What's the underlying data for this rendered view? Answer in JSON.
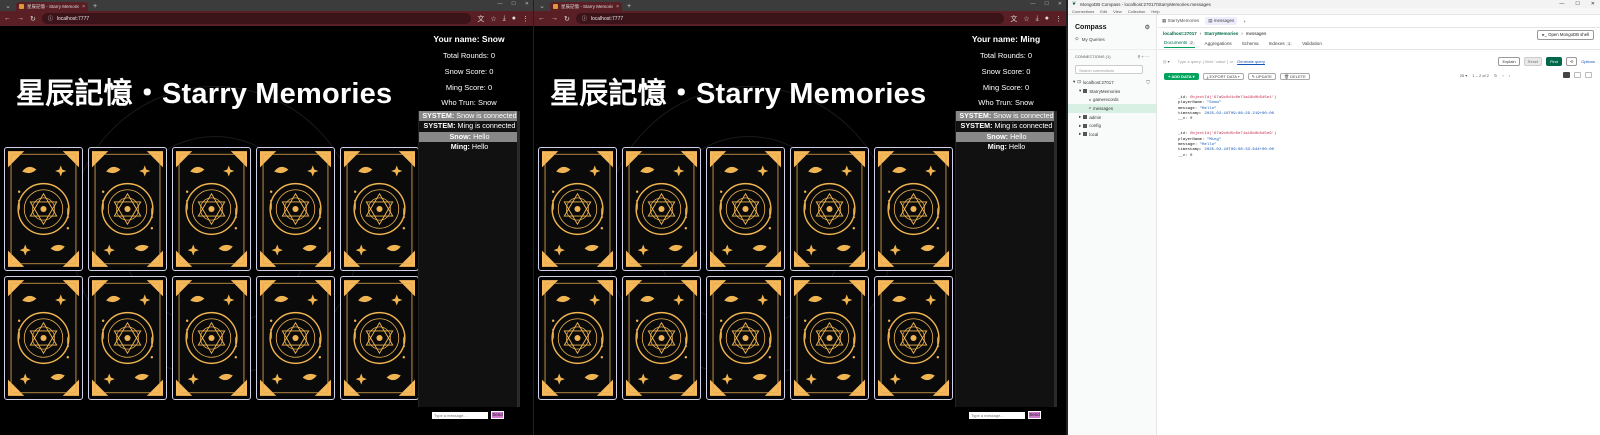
{
  "browsers": [
    {
      "tab_title": "星辰記憶 - Starry Memories",
      "url": "localhost:7777",
      "game_title": "星辰記憶・Starry Memories",
      "your_name_label": "Your name: Snow",
      "total_rounds": "Total Rounds: 0",
      "snow_score": "Snow Score: 0",
      "ming_score": "Ming Score: 0",
      "who_turn": "Who Trun: Snow",
      "messages": [
        {
          "sender": "SYSTEM:",
          "text": "Snow is connected",
          "highlight": true
        },
        {
          "sender": "SYSTEM:",
          "text": "Ming is connected",
          "highlight": false
        },
        {
          "sender": "Snow:",
          "text": "Hello",
          "highlight": true
        },
        {
          "sender": "Ming:",
          "text": "Hello",
          "highlight": false
        }
      ],
      "chat_placeholder": "Type a message...",
      "send_label": "Send"
    },
    {
      "tab_title": "星辰記憶 - Starry Memories",
      "url": "localhost:7777",
      "game_title": "星辰記憶・Starry Memories",
      "your_name_label": "Your name: Ming",
      "total_rounds": "Total Rounds: 0",
      "snow_score": "Snow Score: 0",
      "ming_score": "Ming Score: 0",
      "who_turn": "Who Trun: Snow",
      "messages": [
        {
          "sender": "SYSTEM:",
          "text": "Snow is connected",
          "highlight": true
        },
        {
          "sender": "SYSTEM:",
          "text": "Ming is connected",
          "highlight": false
        },
        {
          "sender": "Snow:",
          "text": "Hello",
          "highlight": true
        },
        {
          "sender": "Ming:",
          "text": "Hello",
          "highlight": false
        }
      ],
      "chat_placeholder": "Type a message...",
      "send_label": "Send"
    }
  ],
  "card_count": 10,
  "compass": {
    "window_title": "MongoDB Compass - localhost:27017/StarryMemories.messages",
    "menu": [
      "Connections",
      "Edit",
      "View",
      "Collection",
      "Help"
    ],
    "app_name": "Compass",
    "my_queries": "My Queries",
    "connections_label": "CONNECTIONS (1)",
    "search_placeholder": "Search connections",
    "tree": [
      {
        "label": "localhost:27017",
        "level": 0
      },
      {
        "label": "StarryMemories",
        "level": 1
      },
      {
        "label": "gamerecords",
        "level": 2
      },
      {
        "label": "messages",
        "level": 2,
        "selected": true
      },
      {
        "label": "admin",
        "level": 1
      },
      {
        "label": "config",
        "level": 1
      },
      {
        "label": "local",
        "level": 1
      }
    ],
    "top_tabs": [
      "StarryMemories",
      "messages"
    ],
    "breadcrumb": [
      "localhost:27017",
      "StarryMemories",
      "messages"
    ],
    "open_shell": "Open MongoDB shell",
    "sub_tabs": [
      {
        "label": "Documents",
        "badge": "2",
        "active": true
      },
      {
        "label": "Aggregations",
        "badge": "",
        "active": false
      },
      {
        "label": "Schema",
        "badge": "",
        "active": false
      },
      {
        "label": "Indexes",
        "badge": "1",
        "active": false
      },
      {
        "label": "Validation",
        "badge": "",
        "active": false
      }
    ],
    "query_placeholder": "Type a query: { field: 'value' } or",
    "query_link": "Generate query",
    "buttons": {
      "explain": "Explain",
      "reset": "Reset",
      "find": "Find",
      "options": "Options"
    },
    "add_data": "ADD DATA",
    "export_data": "EXPORT DATA",
    "update": "UPDATE",
    "delete": "DELETE",
    "page_size": "25",
    "page_range": "1 – 2 of 2",
    "documents": [
      {
        "id": "ObjectId('67a9c0d1c0e71a18b0b5d5e1')",
        "playerName": "\"Snow\"",
        "message": "\"Hello\"",
        "timestamp": "2025-02-10T09:08:29.219+00:00",
        "v": "0"
      },
      {
        "id": "ObjectId('67a9c0d5c0e71a18b0b5d5e9')",
        "playerName": "\"Ming\"",
        "message": "\"Hello\"",
        "timestamp": "2025-02-10T09:08:33.644+00:00",
        "v": "0"
      }
    ]
  }
}
